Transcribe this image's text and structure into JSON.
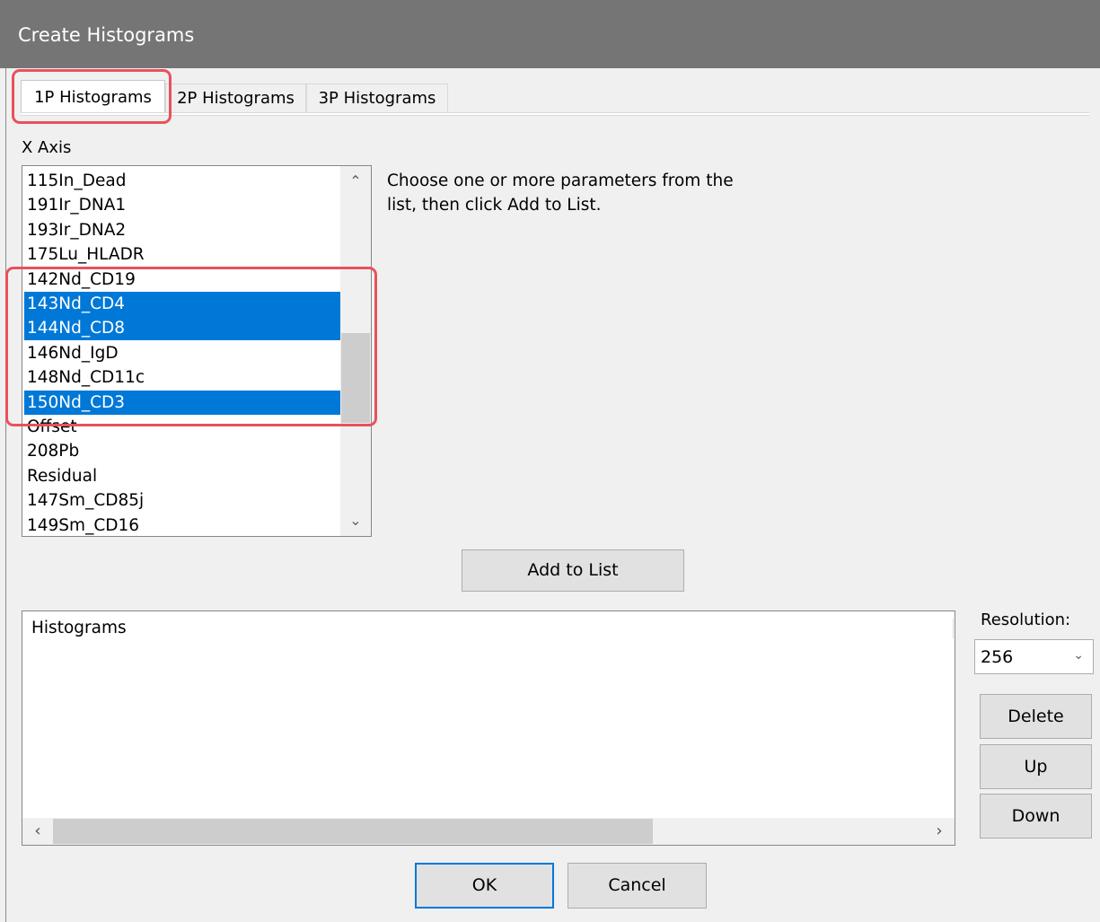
{
  "window": {
    "title": "Create Histograms"
  },
  "tabs": [
    {
      "label": "1P Histograms",
      "active": true
    },
    {
      "label": "2P Histograms",
      "active": false
    },
    {
      "label": "3P Histograms",
      "active": false
    }
  ],
  "x_axis": {
    "label": "X Axis",
    "items": [
      {
        "label": "115In_Dead",
        "selected": false
      },
      {
        "label": "191Ir_DNA1",
        "selected": false
      },
      {
        "label": "193Ir_DNA2",
        "selected": false
      },
      {
        "label": "175Lu_HLADR",
        "selected": false
      },
      {
        "label": "142Nd_CD19",
        "selected": false
      },
      {
        "label": "143Nd_CD4",
        "selected": true
      },
      {
        "label": "144Nd_CD8",
        "selected": true
      },
      {
        "label": "146Nd_IgD",
        "selected": false
      },
      {
        "label": "148Nd_CD11c",
        "selected": false
      },
      {
        "label": "150Nd_CD3",
        "selected": true
      },
      {
        "label": "Offset",
        "selected": false
      },
      {
        "label": "208Pb",
        "selected": false
      },
      {
        "label": "Residual",
        "selected": false
      },
      {
        "label": "147Sm_CD85j",
        "selected": false
      },
      {
        "label": "149Sm_CD16",
        "selected": false
      }
    ],
    "help_text": "Choose one or more parameters from the list, then click Add to List."
  },
  "buttons": {
    "add_to_list": "Add to List",
    "delete": "Delete",
    "up": "Up",
    "down": "Down",
    "ok": "OK",
    "cancel": "Cancel"
  },
  "histograms": {
    "header": "Histograms"
  },
  "resolution": {
    "label": "Resolution:",
    "value": "256"
  },
  "colors": {
    "selection": "#0078d7",
    "highlight": "#e8525a",
    "titlebar": "#757575"
  }
}
